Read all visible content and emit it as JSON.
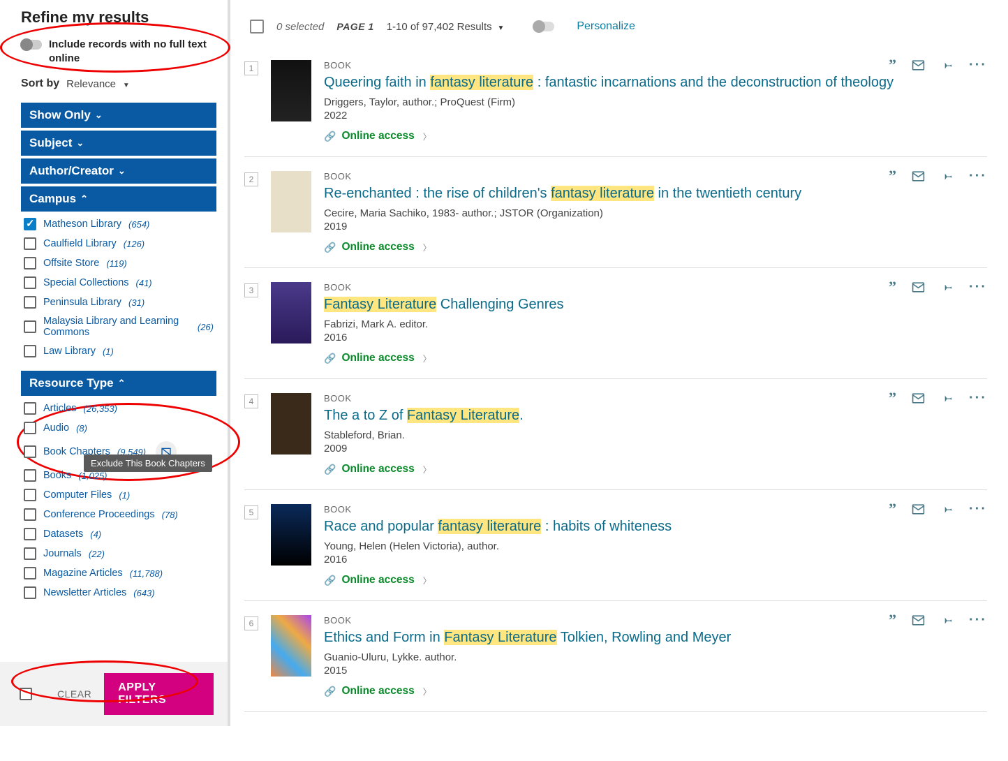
{
  "sidebar": {
    "refine_title": "Refine my results",
    "include_toggle_label": "Include records with no full text online",
    "sort_label": "Sort by",
    "sort_value": "Relevance",
    "facets": {
      "show_only": {
        "label": "Show Only",
        "expanded": false
      },
      "subject": {
        "label": "Subject",
        "expanded": false
      },
      "author": {
        "label": "Author/Creator",
        "expanded": false
      },
      "campus": {
        "label": "Campus",
        "expanded": true,
        "items": [
          {
            "label": "Matheson Library",
            "count": "(654)",
            "checked": true
          },
          {
            "label": "Caulfield Library",
            "count": "(126)",
            "checked": false
          },
          {
            "label": "Offsite Store",
            "count": "(119)",
            "checked": false
          },
          {
            "label": "Special Collections",
            "count": "(41)",
            "checked": false
          },
          {
            "label": "Peninsula Library",
            "count": "(31)",
            "checked": false
          },
          {
            "label": "Malaysia Library and Learning Commons",
            "count": "(26)",
            "checked": false,
            "count_right": true
          },
          {
            "label": "Law Library",
            "count": "(1)",
            "checked": false
          }
        ]
      },
      "resource_type": {
        "label": "Resource Type",
        "expanded": true,
        "items": [
          {
            "label": "Articles",
            "count": "(26,353)"
          },
          {
            "label": "Audio",
            "count": "(8)"
          },
          {
            "label": "Book Chapters",
            "count": "(9,549)",
            "exclude_shown": true
          },
          {
            "label": "Books",
            "count": "(1,025)"
          },
          {
            "label": "Computer Files",
            "count": "(1)"
          },
          {
            "label": "Conference Proceedings",
            "count": "(78)"
          },
          {
            "label": "Datasets",
            "count": "(4)"
          },
          {
            "label": "Journals",
            "count": "(22)"
          },
          {
            "label": "Magazine Articles",
            "count": "(11,788)"
          },
          {
            "label": "Newsletter Articles",
            "count": "(643)"
          }
        ]
      }
    },
    "exclude_tooltip": "Exclude This Book Chapters",
    "clear_label": "CLEAR",
    "apply_label": "APPLY FILTERS"
  },
  "topbar": {
    "selected": "0 selected",
    "page": "PAGE 1",
    "range": "1-10 of 97,402 Results",
    "personalize": "Personalize"
  },
  "results": [
    {
      "num": "1",
      "type": "BOOK",
      "title_pre": "Queering faith in ",
      "title_hl": "fantasy literature",
      "title_post": " : fantastic incarnations and the deconstruction of theology",
      "authors": "Driggers, Taylor, author.; ProQuest (Firm)",
      "year": "2022",
      "online": "Online access"
    },
    {
      "num": "2",
      "type": "BOOK",
      "title_pre": "Re-enchanted : the rise of children's ",
      "title_hl": "fantasy literature",
      "title_post": " in the twentieth century",
      "authors": "Cecire, Maria Sachiko, 1983- author.; JSTOR (Organization)",
      "year": "2019",
      "online": "Online access"
    },
    {
      "num": "3",
      "type": "BOOK",
      "title_pre": "",
      "title_hl": "Fantasy Literature",
      "title_post": " Challenging Genres",
      "authors": "Fabrizi, Mark A. editor.",
      "year": "2016",
      "online": "Online access"
    },
    {
      "num": "4",
      "type": "BOOK",
      "title_pre": "The a to Z of ",
      "title_hl": "Fantasy Literature",
      "title_post": ".",
      "authors": "Stableford, Brian.",
      "year": "2009",
      "online": "Online access"
    },
    {
      "num": "5",
      "type": "BOOK",
      "title_pre": "Race and popular ",
      "title_hl": "fantasy literature",
      "title_post": " : habits of whiteness",
      "authors": "Young, Helen (Helen Victoria), author.",
      "year": "2016",
      "online": "Online access"
    },
    {
      "num": "6",
      "type": "BOOK",
      "title_pre": "Ethics and Form in ",
      "title_hl": "Fantasy Literature",
      "title_post": " Tolkien, Rowling and Meyer",
      "authors": "Guanio-Uluru, Lykke. author.",
      "year": "2015",
      "online": "Online access"
    }
  ]
}
